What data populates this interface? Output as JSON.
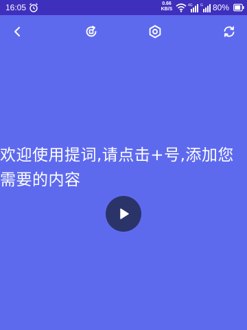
{
  "status_bar": {
    "time": "16:05",
    "network_speed_value": "0.66",
    "network_speed_unit": "KB/S",
    "signal_1_label": "4G",
    "signal_2_label": "G",
    "battery_percent": "80%"
  },
  "toolbar": {
    "icons": [
      "back-arrow-icon",
      "rotate-screen-icon",
      "settings-icon",
      "refresh-icon"
    ]
  },
  "main": {
    "prompt_text": "欢迎使用提词,请点击+号,添加您需要的内容"
  },
  "player": {
    "icon": "play-icon"
  },
  "colors": {
    "background": "#5e6aee",
    "status_bar": "#3f2fbd",
    "play_button": "#2b3468",
    "text": "#ffffff"
  }
}
